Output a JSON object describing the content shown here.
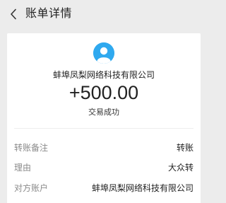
{
  "header": {
    "title": "账单详情",
    "back_icon": "chevron-left-icon"
  },
  "summary": {
    "avatar_icon": "user-avatar-icon",
    "avatar_color": "#2fa9ef",
    "counterparty": "蚌埠凤梨网络科技有限公司",
    "amount": "+500.00",
    "status": "交易成功"
  },
  "details": [
    {
      "label": "转账备注",
      "value": "转账"
    },
    {
      "label": "理由",
      "value": "大众转"
    },
    {
      "label": "对方账户",
      "value": "蚌埠凤梨网络科技有限公司"
    }
  ]
}
